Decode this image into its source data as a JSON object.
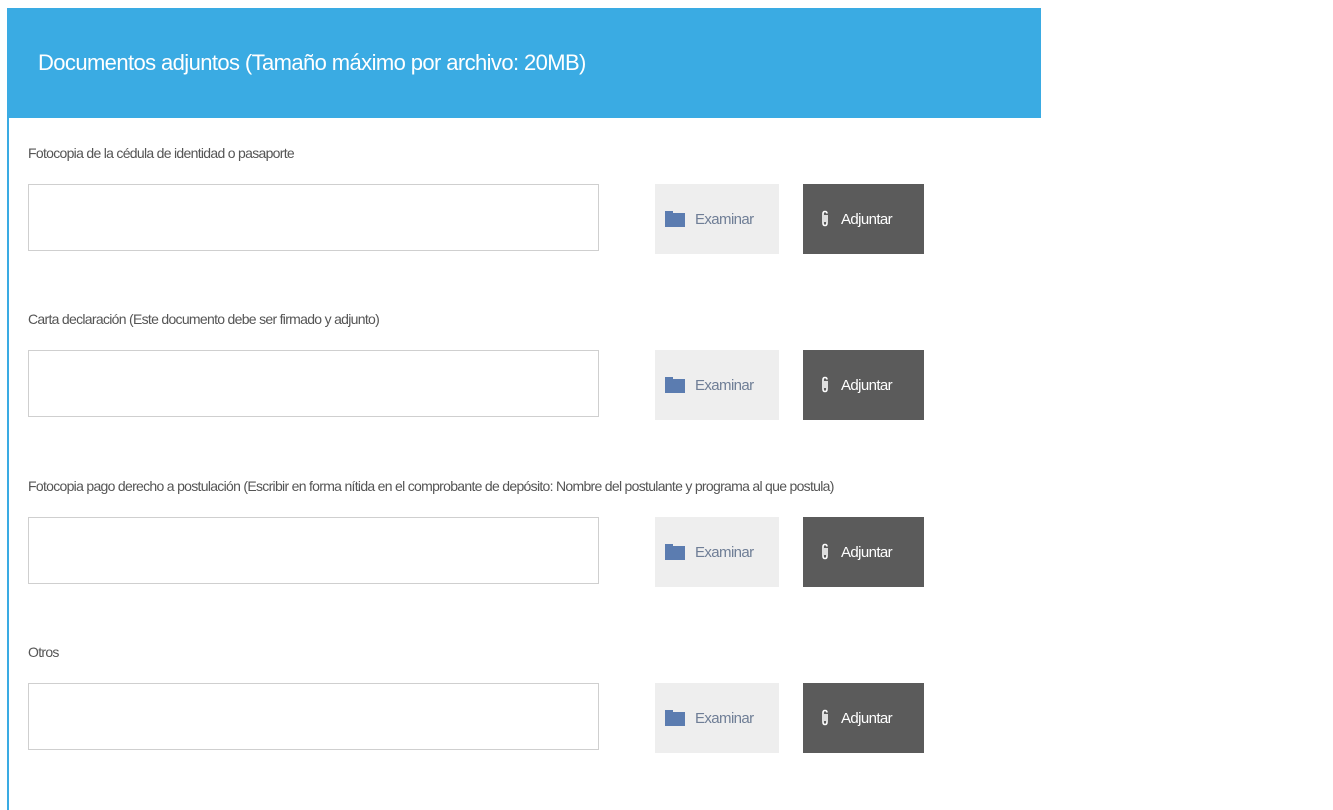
{
  "header": {
    "title": "Documentos adjuntos (Tamaño máximo por archivo: 20MB)"
  },
  "colors": {
    "header_bg": "#3aabe3",
    "browse_bg": "#eeeeee",
    "attach_bg": "#5b5b5b"
  },
  "fields": [
    {
      "label": "Fotocopia de la cédula de identidad o pasaporte",
      "value": "",
      "browse_label": "Examinar",
      "attach_label": "Adjuntar"
    },
    {
      "label": "Carta declaración (Este documento debe ser firmado y adjunto)",
      "value": "",
      "browse_label": "Examinar",
      "attach_label": "Adjuntar"
    },
    {
      "label": "Fotocopia pago derecho a postulación (Escribir en forma nítida en el comprobante de depósito: Nombre del postulante y programa al que postula)",
      "value": "",
      "browse_label": "Examinar",
      "attach_label": "Adjuntar"
    },
    {
      "label": "Otros",
      "value": "",
      "browse_label": "Examinar",
      "attach_label": "Adjuntar"
    }
  ],
  "icons": {
    "browse": "folder-icon",
    "attach": "paperclip-icon"
  }
}
